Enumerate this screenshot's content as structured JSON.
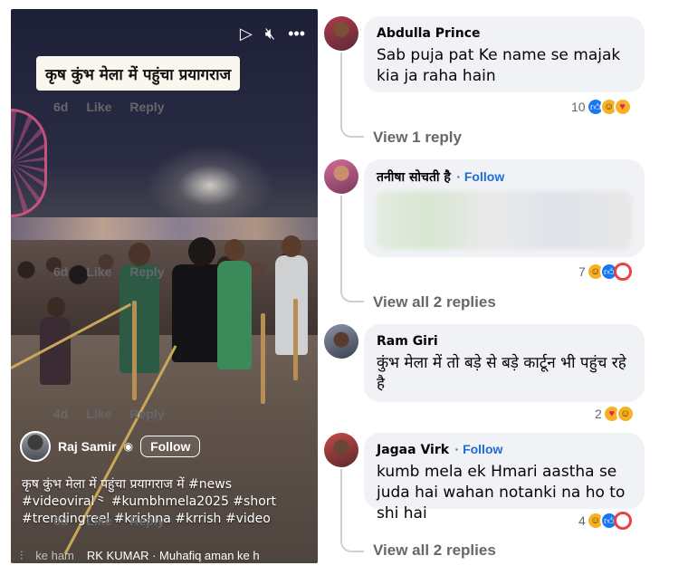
{
  "video": {
    "title_banner": "कृष कुंभ मेला में पहुंचा प्रयागराज",
    "controls": {
      "play_icon": "▷",
      "mute_icon": "🔇︎",
      "more_icon": "•••"
    },
    "author": {
      "name": "Raj Samir",
      "follow_label": "Follow"
    },
    "caption_lines": [
      "कृष कुंभ मेला में पहुंचा प्रयागराज में #news",
      "#videoviral⺀ #kumbhmela2025 #short",
      " #trendingreel #krishna #krrish #video"
    ],
    "music": {
      "prefix": "ke ham",
      "artist": "RK KUMAR · Muhafiq aman ke h"
    }
  },
  "comments": [
    {
      "name": "Abdulla Prince",
      "follow": "",
      "text": "Sab puja pat Ke name se majak kia ja raha hain",
      "time": "6d",
      "like": "Like",
      "reply": "Reply",
      "reaction_count": "10",
      "reactions": [
        "like",
        "haha",
        "care"
      ],
      "replies_label": "View 1 reply"
    },
    {
      "name": "तनीषा सोचती है",
      "follow": "· Follow",
      "text": "",
      "time": "6d",
      "like": "Like",
      "reply": "Reply",
      "reaction_count": "7",
      "reactions": [
        "haha",
        "like",
        "angry"
      ],
      "replies_label": "View all 2 replies"
    },
    {
      "name": "Ram Giri",
      "follow": "",
      "text": "कुंभ मेला में तो बड़े से बड़े कार्टून भी पहुंच रहे है",
      "time": "4d",
      "like": "Like",
      "reply": "Reply",
      "reaction_count": "2",
      "reactions": [
        "care",
        "haha"
      ],
      "replies_label": ""
    },
    {
      "name": "Jagaa Virk",
      "follow": "· Follow",
      "text": "kumb mela ek Hmari aastha se juda hai wahan notanki na ho to shi hai",
      "time": "6d",
      "like": "Like",
      "reply": "Reply",
      "reaction_count": "4",
      "reactions": [
        "haha",
        "like",
        "angry"
      ],
      "replies_label": "View all 2 replies"
    }
  ],
  "colors": {
    "link_blue": "#1a6ed8",
    "bubble_gray": "#f0f2f5",
    "meta_gray": "#65676b",
    "like_blue": "#1877f2"
  }
}
